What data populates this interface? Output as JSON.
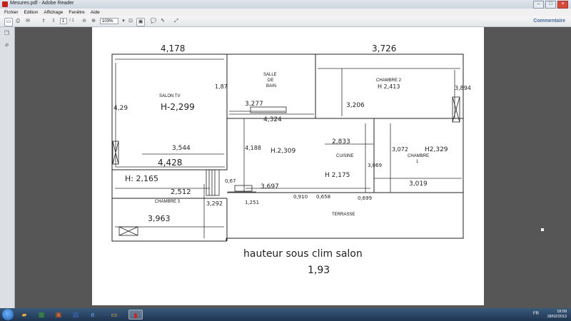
{
  "window": {
    "title": "Mesures.pdf - Adobe Reader"
  },
  "menu": [
    "Fichier",
    "Edition",
    "Affichage",
    "Fenêtre",
    "Aide"
  ],
  "toolbar": {
    "page_current": "1",
    "page_total": "/ 1",
    "zoom": "103%",
    "comment_label": "Commentaire"
  },
  "plan": {
    "rooms": {
      "salon": "SALON TV",
      "salle_line1": "SALLE",
      "salle_line2": "DE",
      "salle_line3": "BAIN",
      "chambre2": "CHAMBRE 2",
      "cuisine": "CUISINE",
      "chambre1_line1": "CHAMBRE",
      "chambre1_line2": "1",
      "chambre3": "CHAMBRE 3",
      "terrasse": "TERRASSE"
    },
    "measures": {
      "m4178": "4,178",
      "m3726": "3,726",
      "m429": "4,29",
      "m187": "1,87",
      "h2299": "H-2,299",
      "h2413": "H 2,413",
      "m3894": "3,894",
      "m3277": "3,277",
      "m4324": "4,324",
      "m3206": "3,206",
      "m3544": "3,544",
      "m4428": "4,428",
      "m4188": "4,188",
      "h2309": "H.2,309",
      "m2833": "2,833",
      "m3072": "3,072",
      "h2329": "H2,329",
      "m3069": "3,069",
      "h2175": "H 2,175",
      "h2165": "H: 2,165",
      "m067": "0,67",
      "m2512": "2,512",
      "m3292": "3,292",
      "m3697": "3,697",
      "m3019": "3,019",
      "m1251": "1,251",
      "m0910": "0,910",
      "m0658": "0,658",
      "m0699": "0,699",
      "m3963": "3,963"
    },
    "note_line1": "hauteur sous clim salon",
    "note_line2": "1,93"
  },
  "taskbar": {
    "time": "18:09",
    "date": "18/02/2013",
    "lang": "FR"
  }
}
